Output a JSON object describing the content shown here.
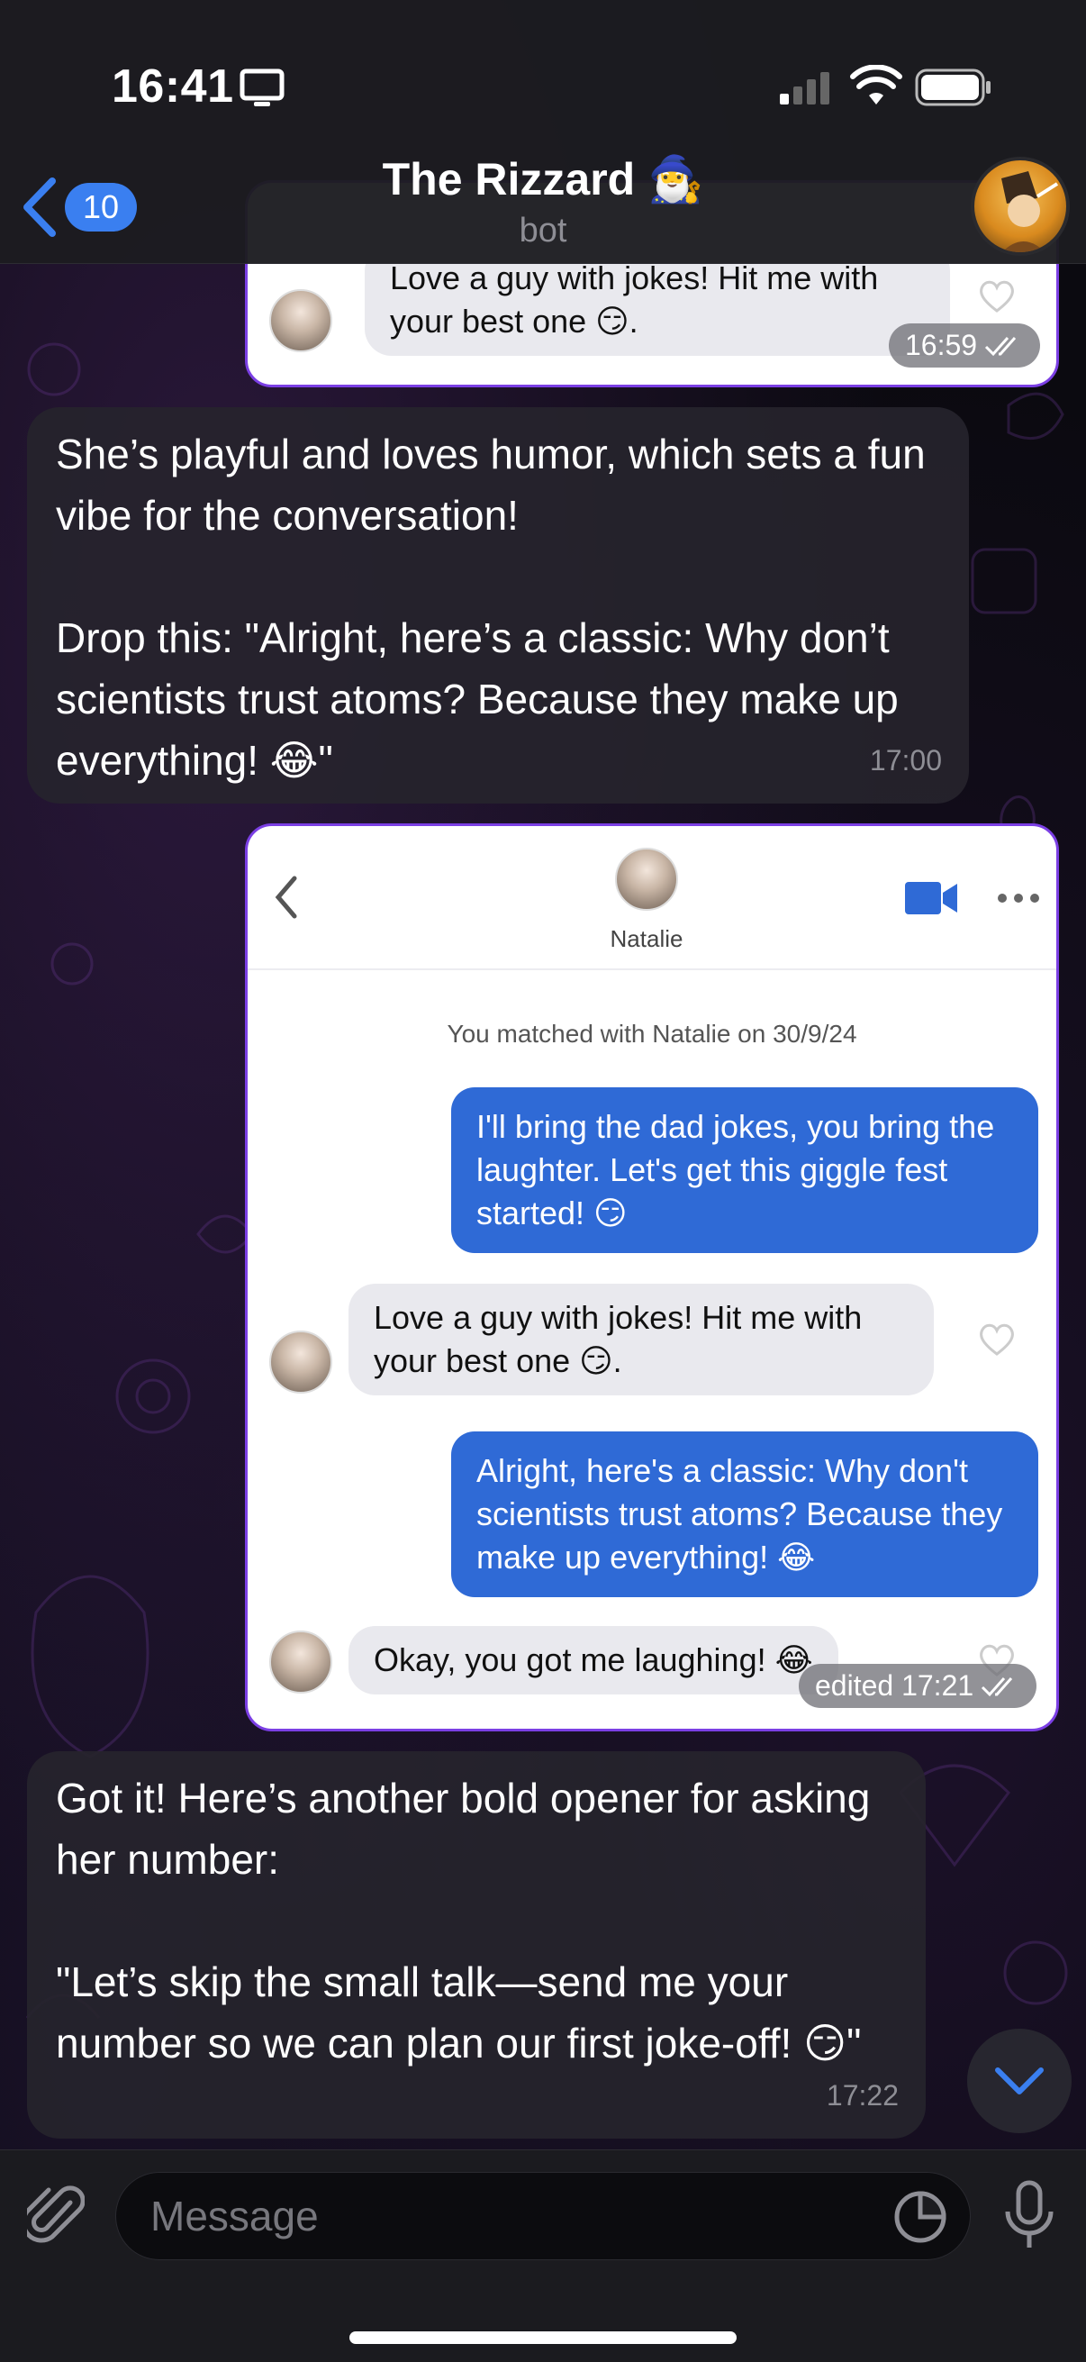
{
  "status_bar": {
    "time": "16:41"
  },
  "header": {
    "back_badge": "10",
    "title": "The Rizzard 🧙‍♂️",
    "subtitle": "bot"
  },
  "messages": {
    "shot1": {
      "gray_text": "Love a guy with jokes! Hit me with your best one 😏.",
      "time": "16:59"
    },
    "reply1": {
      "text": "She’s playful and loves humor, which sets a fun vibe for the conversation!\n\nDrop this: \"Alright, here’s a classic: Why don’t scientists trust atoms? Because they make up everything! 😂\"",
      "time": "17:00"
    },
    "shot2": {
      "contact_name": "Natalie",
      "matched": "You matched with Natalie on 30/9/24",
      "blue1": "I'll bring the dad jokes, you bring the laughter. Let's get this giggle fest started! 😏",
      "gray1": "Love a guy with jokes! Hit me with your best one 😏.",
      "blue2": "Alright, here's a classic: Why don't scientists trust atoms? Because they make up everything! 😂",
      "gray2": "Okay, you got me laughing! 😂",
      "time": "edited 17:21"
    },
    "reply2": {
      "text": "Got it! Here’s another bold opener for asking her number:\n\n\"Let’s skip the small talk—send me your number so we can plan our first joke-off! 😏\"",
      "time": "17:22"
    }
  },
  "input": {
    "placeholder": "Message"
  },
  "colors": {
    "accent": "#3a7ff0",
    "inner_blue": "#2f6ad6",
    "bubble_border": "#7b3fe4"
  }
}
